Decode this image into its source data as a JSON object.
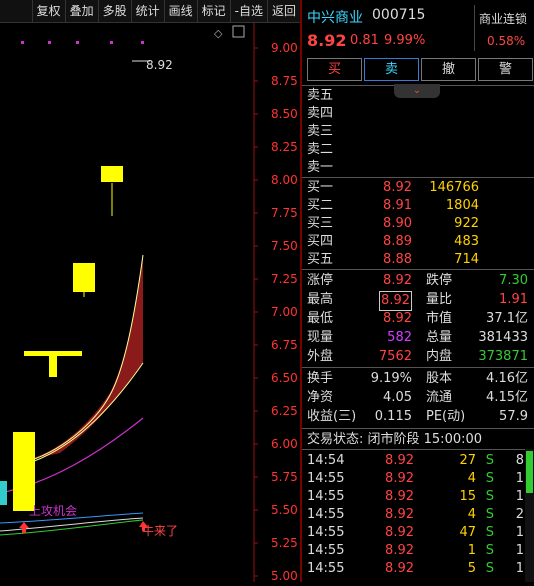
{
  "toolbar": [
    "复权",
    "叠加",
    "多股",
    "统计",
    "画线",
    "标记",
    "-自选",
    "返回"
  ],
  "chart": {
    "y_ticks": [
      "9.00",
      "8.75",
      "8.50",
      "8.25",
      "8.00",
      "7.75",
      "7.50",
      "7.25",
      "7.00",
      "6.75",
      "6.50",
      "6.25",
      "6.00",
      "5.75",
      "5.50",
      "5.25",
      "5.00"
    ],
    "high_label": "8.92",
    "annot_buy": "上攻机会",
    "annot_cow": "牛来了",
    "colors": {
      "up": "#ffff00",
      "band": "#8b1a1a",
      "line_pink": "#cc33cc",
      "axis": "#ff3333"
    }
  },
  "stock": {
    "name": "中兴商业",
    "code": "000715",
    "price": "8.92",
    "change": "0.81",
    "pct": "9.99%",
    "sector": "商业连锁",
    "sector_pct": "0.58%"
  },
  "trade_buttons": {
    "buy": "买",
    "sell": "卖",
    "cancel": "撤",
    "alert": "警"
  },
  "sell_levels": [
    "卖五",
    "卖四",
    "卖三",
    "卖二",
    "卖一"
  ],
  "buy_levels": [
    {
      "label": "买一",
      "price": "8.92",
      "vol": "146766"
    },
    {
      "label": "买二",
      "price": "8.91",
      "vol": "1804"
    },
    {
      "label": "买三",
      "price": "8.90",
      "vol": "922"
    },
    {
      "label": "买四",
      "price": "8.89",
      "vol": "483"
    },
    {
      "label": "买五",
      "price": "8.88",
      "vol": "714"
    }
  ],
  "quote": {
    "zt_label": "涨停",
    "zt": "8.92",
    "dt_label": "跌停",
    "dt": "7.30",
    "high_label": "最高",
    "high": "8.92",
    "lb_label": "量比",
    "lb": "1.91",
    "low_label": "最低",
    "low": "8.92",
    "sz_label": "市值",
    "sz": "37.1亿",
    "xl_label": "现量",
    "xl": "582",
    "zl_label": "总量",
    "zl": "381433",
    "wp_label": "外盘",
    "wp": "7562",
    "np_label": "内盘",
    "np": "373871",
    "hs_label": "换手",
    "hs": "9.19%",
    "gb_label": "股本",
    "gb": "4.16亿",
    "jz_label": "净资",
    "jz": "4.05",
    "lt_label": "流通",
    "lt": "4.15亿",
    "sy_label": "收益(三)",
    "sy": "0.115",
    "pe_label": "PE(动)",
    "pe": "57.9"
  },
  "status": "交易状态: 闭市阶段 15:00:00",
  "ticks": [
    {
      "time": "14:54",
      "price": "8.92",
      "vol": "27",
      "side": "S",
      "num": "8"
    },
    {
      "time": "14:55",
      "price": "8.92",
      "vol": "4",
      "side": "S",
      "num": "1"
    },
    {
      "time": "14:55",
      "price": "8.92",
      "vol": "15",
      "side": "S",
      "num": "1"
    },
    {
      "time": "14:55",
      "price": "8.92",
      "vol": "4",
      "side": "S",
      "num": "2"
    },
    {
      "time": "14:55",
      "price": "8.92",
      "vol": "47",
      "side": "S",
      "num": "1"
    },
    {
      "time": "14:55",
      "price": "8.92",
      "vol": "1",
      "side": "S",
      "num": "1"
    },
    {
      "time": "14:55",
      "price": "8.92",
      "vol": "5",
      "side": "S",
      "num": "1"
    }
  ]
}
